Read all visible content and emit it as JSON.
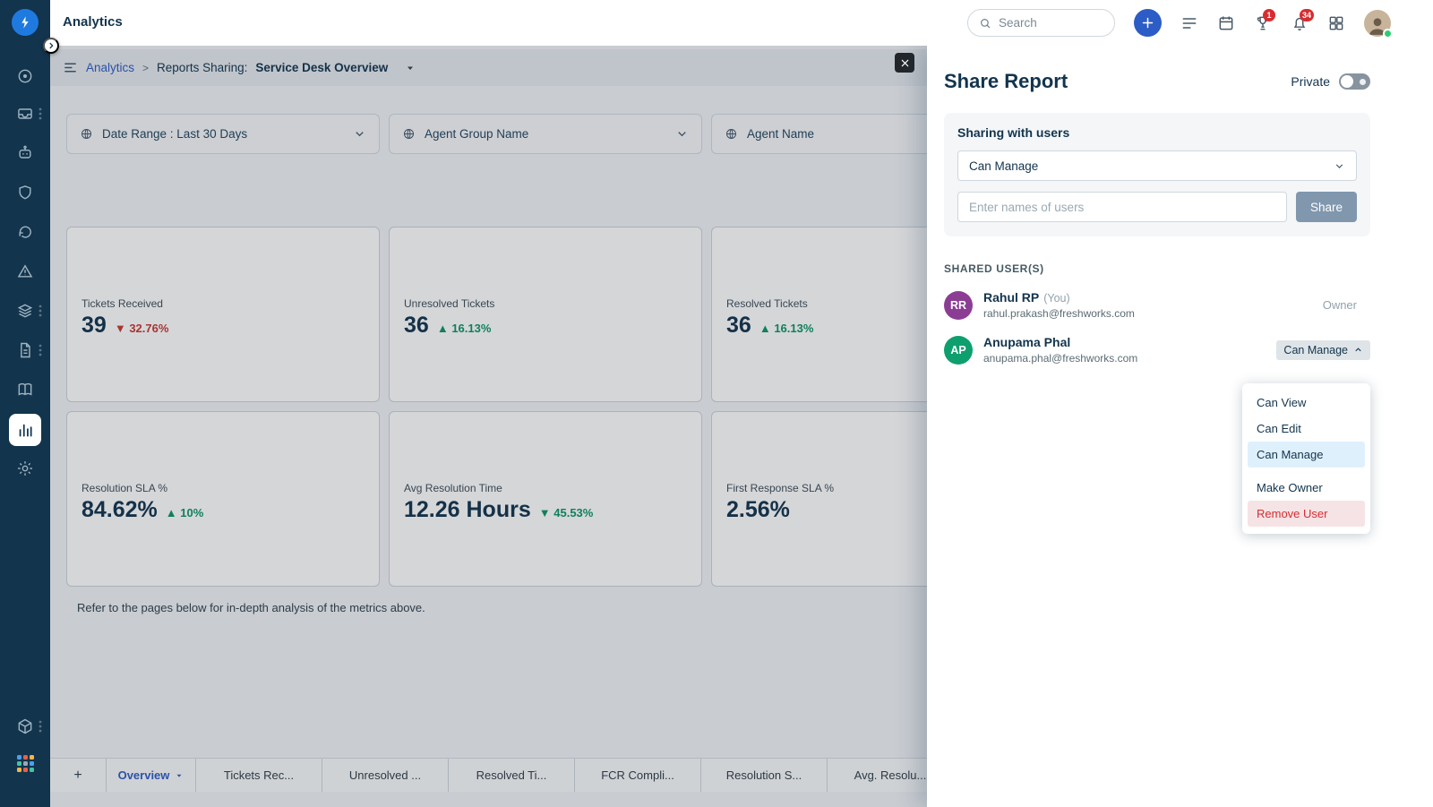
{
  "app": {
    "title": "Analytics",
    "search_placeholder": "Search",
    "badges": {
      "whats_new": "1",
      "notifications": "34"
    }
  },
  "breadcrumb": {
    "root": "Analytics",
    "separator": ">",
    "section": "Reports Sharing:",
    "report_name": "Service Desk Overview"
  },
  "filters": [
    {
      "label": "Date Range :  Last 30 Days"
    },
    {
      "label": "Agent Group Name"
    },
    {
      "label": "Agent Name"
    }
  ],
  "metrics": [
    {
      "label": "Tickets Received",
      "value": "39",
      "arrow": "▼",
      "delta": "32.76%",
      "trend": "negative"
    },
    {
      "label": "Unresolved Tickets",
      "value": "36",
      "arrow": "▲",
      "delta": "16.13%",
      "trend": "positive"
    },
    {
      "label": "Resolved Tickets",
      "value": "36",
      "arrow": "▲",
      "delta": "16.13%",
      "trend": "positive"
    },
    {
      "label": "Resolution SLA %",
      "value": "84.62%",
      "arrow": "▲",
      "delta": "10%",
      "trend": "positive"
    },
    {
      "label": "Avg Resolution Time",
      "value": "12.26 Hours",
      "arrow": "▼",
      "delta": "45.53%",
      "trend": "positive"
    },
    {
      "label": "First Response SLA %",
      "value": "2.56%",
      "arrow": "",
      "delta": "",
      "trend": "none"
    }
  ],
  "note": "Refer to the pages below for in-depth analysis of the metrics above.",
  "tabs": {
    "add": "+",
    "items": [
      {
        "label": "Overview"
      },
      {
        "label": "Tickets Rec..."
      },
      {
        "label": "Unresolved ..."
      },
      {
        "label": "Resolved Ti..."
      },
      {
        "label": "FCR Compli..."
      },
      {
        "label": "Resolution S..."
      },
      {
        "label": "Avg. Resolu..."
      }
    ]
  },
  "share_panel": {
    "title": "Share Report",
    "private_label": "Private",
    "card_title": "Sharing with users",
    "permission_selected": "Can Manage",
    "user_input_placeholder": "Enter names of users",
    "share_button": "Share",
    "shared_users_heading": "SHARED USER(S)",
    "users": [
      {
        "initials": "RR",
        "name": "Rahul RP",
        "name_suffix": "(You)",
        "email": "rahul.prakash@freshworks.com",
        "access": "Owner"
      },
      {
        "initials": "AP",
        "name": "Anupama Phal",
        "name_suffix": "",
        "email": "anupama.phal@freshworks.com",
        "access": "Can Manage"
      }
    ],
    "permission_menu": {
      "options": [
        "Can View",
        "Can Edit",
        "Can Manage"
      ],
      "selected": "Can Manage",
      "actions": [
        "Make Owner",
        "Remove User"
      ]
    }
  },
  "colors": {
    "accent_blue": "#2c5cc5",
    "sidebar_navy": "#12344d",
    "positive_green": "#0c9466",
    "negative_red": "#c63934",
    "badge_red": "#d72d30",
    "menu_selected_bg": "#dff0fd",
    "remove_user_bg": "#f6e3e5",
    "avatar_purple": "#8b3d94",
    "avatar_green": "#0e9f6e"
  }
}
